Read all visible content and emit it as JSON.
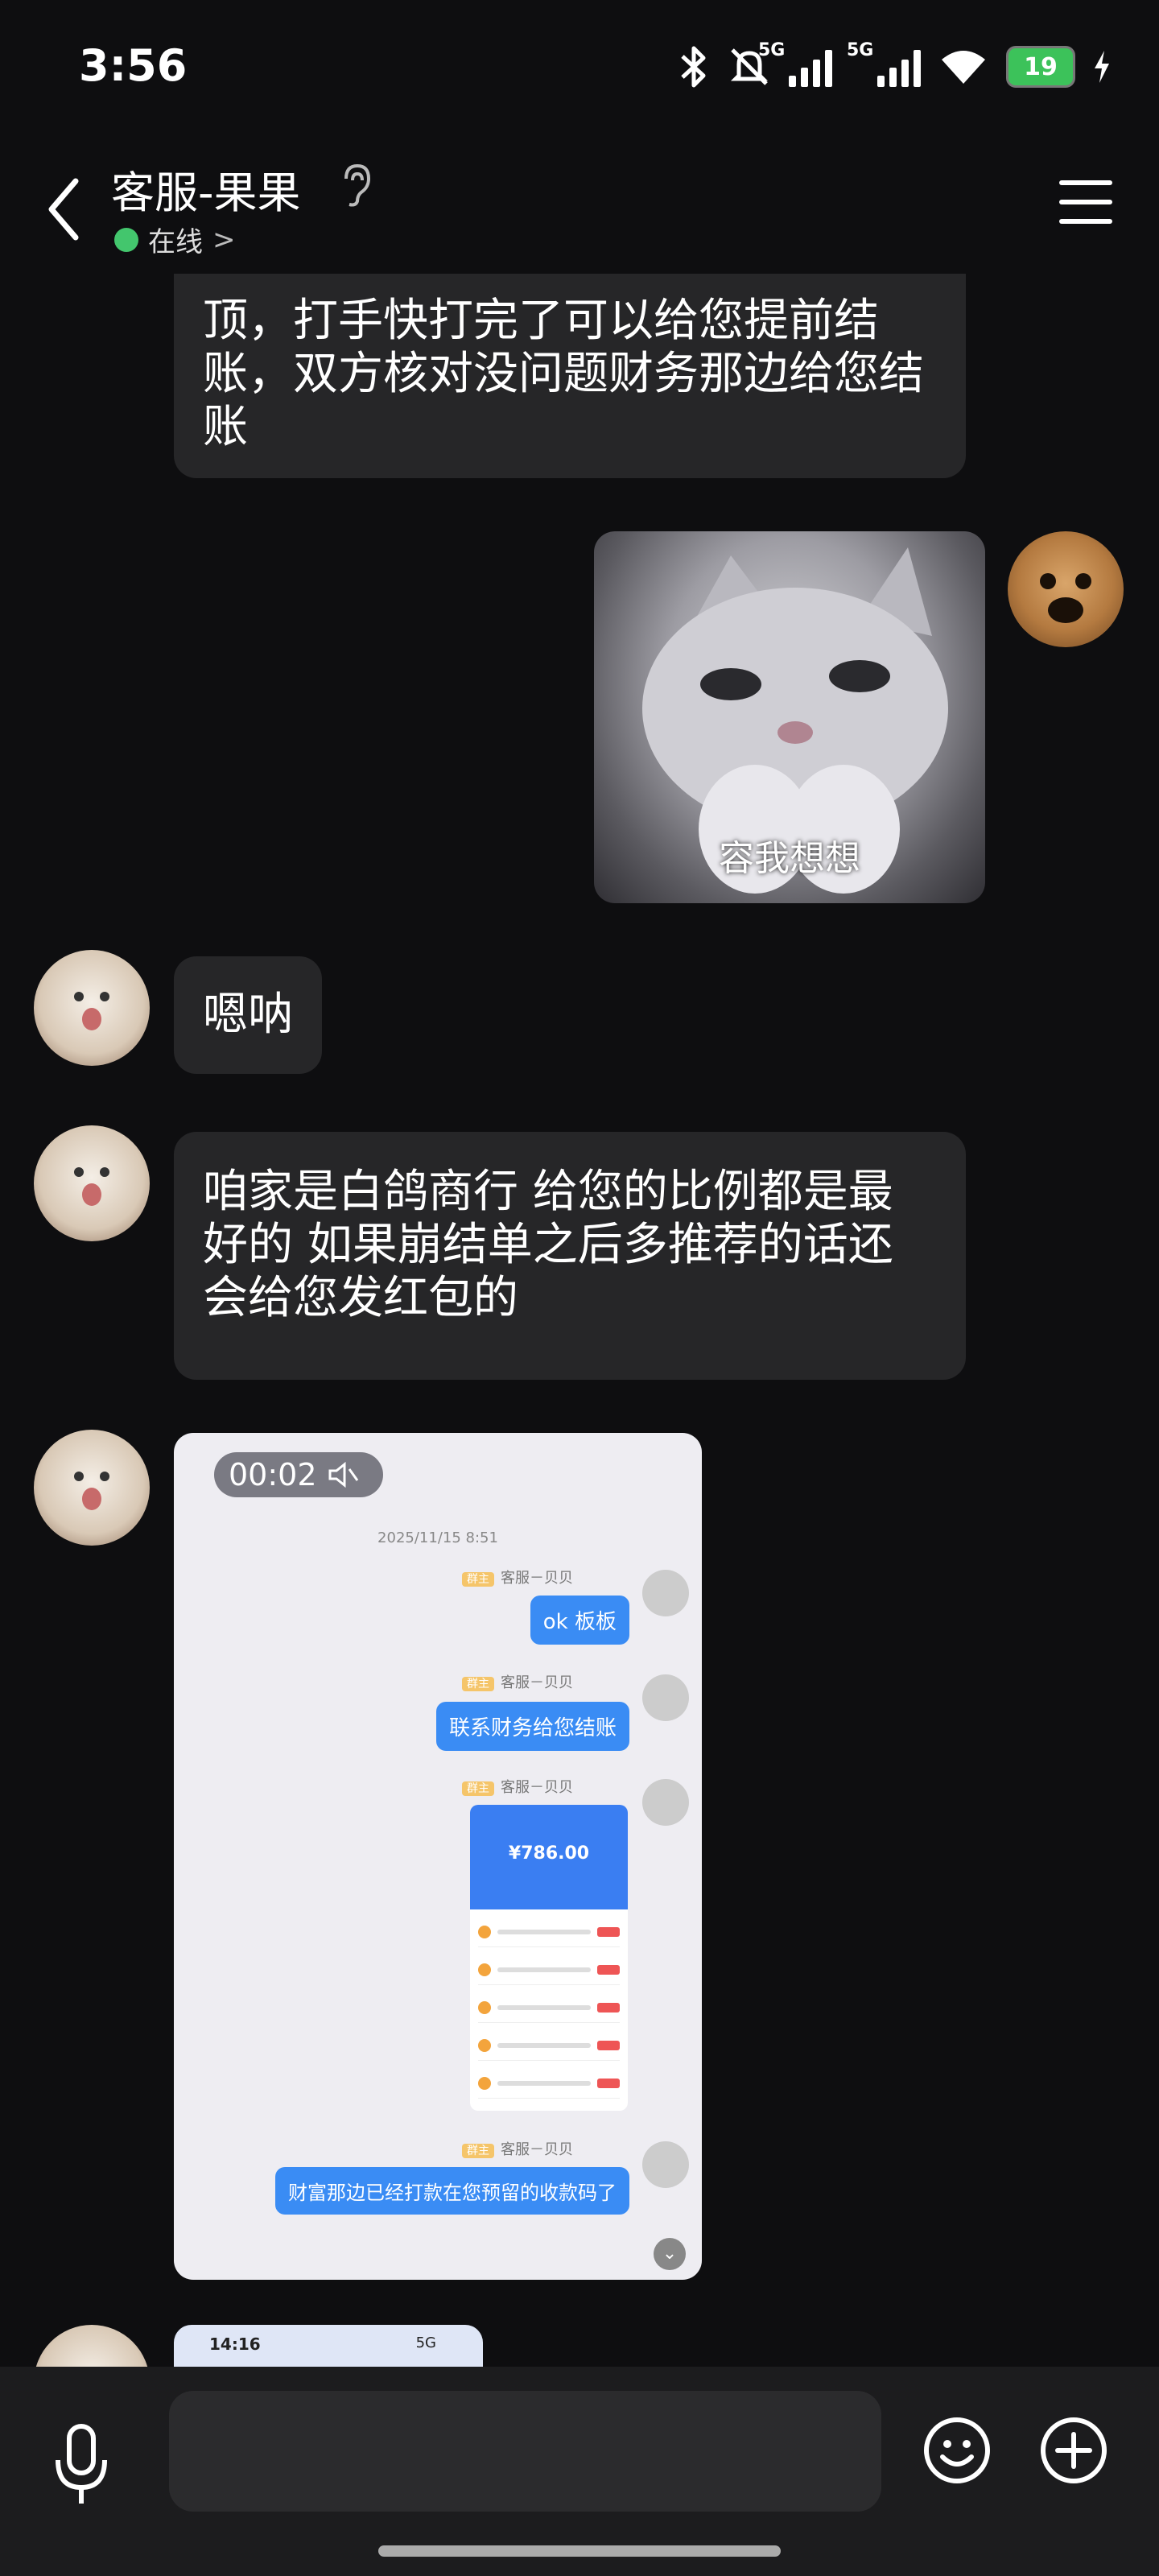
{
  "status": {
    "time": "3:56",
    "net1": "5G",
    "net2": "5G",
    "battery": "19"
  },
  "header": {
    "title": "客服-果果",
    "status": "在线",
    "status_chevron": ">"
  },
  "messages": {
    "m1": "顶，打手快打完了可以给您提前结账，双方核对没问题财务那边给您结账",
    "sticker_caption": "容我想想",
    "m2": "嗯呐",
    "m3": "咱家是白鸽商行 给您的比例都是最好的 如果崩结单之后多推荐的话还会给您发红包的"
  },
  "video": {
    "duration": "00:02",
    "screenshot": {
      "timestamp": "2025/11/15 8:51",
      "tag": "群主",
      "sender": "客服－贝贝",
      "msg1": "ok 板板",
      "msg2": "联系财务给您结账",
      "pay_amount": "¥786.00",
      "msg3": "财富那边已经打款在您预留的收款码了"
    }
  },
  "mini_screenshot": {
    "time": "14:16",
    "net": "5G"
  },
  "icons": [
    "back-icon",
    "ear-icon",
    "menu-icon",
    "mic-icon",
    "emoji-icon",
    "plus-icon",
    "mute-icon",
    "bluetooth-icon",
    "wifi-icon"
  ]
}
